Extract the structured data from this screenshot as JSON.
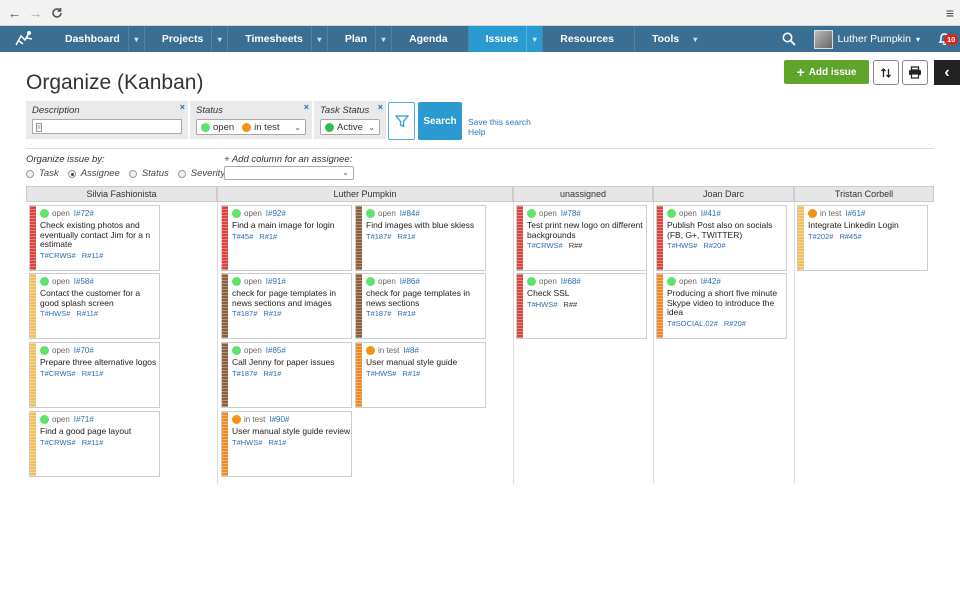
{
  "browser": {
    "back": "←",
    "forward": "→",
    "reload": "C",
    "menu": "≡"
  },
  "nav": {
    "items": [
      {
        "label": "Dashboard"
      },
      {
        "label": "Projects"
      },
      {
        "label": "Timesheets"
      },
      {
        "label": "Plan"
      },
      {
        "label": "Agenda"
      },
      {
        "label": "Issues"
      },
      {
        "label": "Resources"
      },
      {
        "label": "Tools"
      }
    ],
    "active": "Issues",
    "user": "Luther Pumpkin",
    "notifications": "10"
  },
  "page": {
    "title": "Organize (Kanban)",
    "add_issue": "Add issue",
    "close_x": "×"
  },
  "filters": {
    "description_label": "Description",
    "status_label": "Status",
    "status_values": [
      "open",
      "in test"
    ],
    "task_status_label": "Task Status",
    "task_status_value": "Active",
    "search_button": "Search",
    "save_search": "Save this search",
    "help": "Help"
  },
  "organize": {
    "label": "Organize issue by:",
    "options": [
      "Task",
      "Assignee",
      "Status",
      "Severity"
    ],
    "selected": "Assignee",
    "add_column_label": "+ Add column for an assignee:"
  },
  "colors": {
    "open": "#5ee36b",
    "in_test": "#f39214",
    "nav": "#3a6f93",
    "active_nav": "#2a9ad1",
    "add_button": "#5fa52c",
    "red": "#d9453f",
    "brown": "#8b5e3c",
    "yellow": "#f0c060",
    "orange": "#ee8a2a"
  },
  "columns": [
    {
      "name": "Silvia Fashionista",
      "cards": [
        {
          "status": "open",
          "id": "I#72#",
          "title": "Check existing photos and eventually contact Jim for a n estimate",
          "tags": [
            "T#CRWS#",
            "R#11#"
          ],
          "stripe": "red"
        },
        {
          "status": "open",
          "id": "I#58#",
          "title": "Contact the customer for a good splash screen",
          "tags": [
            "T#HWS#",
            "R#11#"
          ],
          "stripe": "yellow"
        },
        {
          "status": "open",
          "id": "I#70#",
          "title": "Prepare three alternative logos",
          "tags": [
            "T#CRWS#",
            "R#11#"
          ],
          "stripe": "yellow"
        },
        {
          "status": "open",
          "id": "I#71#",
          "title": "Find a good page layout",
          "tags": [
            "T#CRWS#",
            "R#11#"
          ],
          "stripe": "yellow"
        }
      ]
    },
    {
      "name": "Luther Pumpkin",
      "cards": [
        {
          "status": "open",
          "id": "I#92#",
          "title": "Find a main image for login",
          "tags": [
            "T#45#",
            "R#1#"
          ],
          "stripe": "red"
        },
        {
          "status": "open",
          "id": "I#84#",
          "title": "Find images with blue skiess",
          "tags": [
            "T#187#",
            "R#1#"
          ],
          "stripe": "brown"
        },
        {
          "status": "open",
          "id": "I#91#",
          "title": "check for page templates in news sections and images",
          "tags": [
            "T#187#",
            "R#1#"
          ],
          "stripe": "brown"
        },
        {
          "status": "open",
          "id": "I#86#",
          "title": "check for page templates in news sections",
          "tags": [
            "T#187#",
            "R#1#"
          ],
          "stripe": "brown"
        },
        {
          "status": "open",
          "id": "I#85#",
          "title": "Call Jenny for paper issues",
          "tags": [
            "T#187#",
            "R#1#"
          ],
          "stripe": "brown"
        },
        {
          "status": "in test",
          "id": "I#8#",
          "title": "User manual style guide",
          "tags": [
            "T#HWS#",
            "R#1#"
          ],
          "stripe": "orange"
        },
        {
          "status": "in test",
          "id": "I#90#",
          "title": "User manual style guide review",
          "tags": [
            "T#HWS#",
            "R#1#"
          ],
          "stripe": "orange"
        }
      ]
    },
    {
      "name": "unassigned",
      "cards": [
        {
          "status": "open",
          "id": "I#78#",
          "title": "Test print new logo on different backgrounds",
          "tags": [
            "T#CRWS#",
            "R##"
          ],
          "stripe": "red"
        },
        {
          "status": "open",
          "id": "I#68#",
          "title": "Check SSL",
          "tags": [
            "T#HWS#",
            "R##"
          ],
          "stripe": "red"
        }
      ]
    },
    {
      "name": "Joan Darc",
      "cards": [
        {
          "status": "open",
          "id": "I#41#",
          "title": "Publish Post also on socials (FB, G+, TWITTER)",
          "tags": [
            "T#HWS#",
            "R#20#"
          ],
          "stripe": "red"
        },
        {
          "status": "open",
          "id": "I#42#",
          "title": "Producing a short five minute Skype video to introduce the idea",
          "tags": [
            "T#SOCIAL.02#",
            "R#20#"
          ],
          "stripe": "orange"
        }
      ]
    },
    {
      "name": "Tristan Corbell",
      "cards": [
        {
          "status": "in test",
          "id": "I#61#",
          "title": "Integrate Linkedin Login",
          "tags": [
            "T#202#",
            "R#45#"
          ],
          "stripe": "yellow"
        }
      ]
    }
  ]
}
